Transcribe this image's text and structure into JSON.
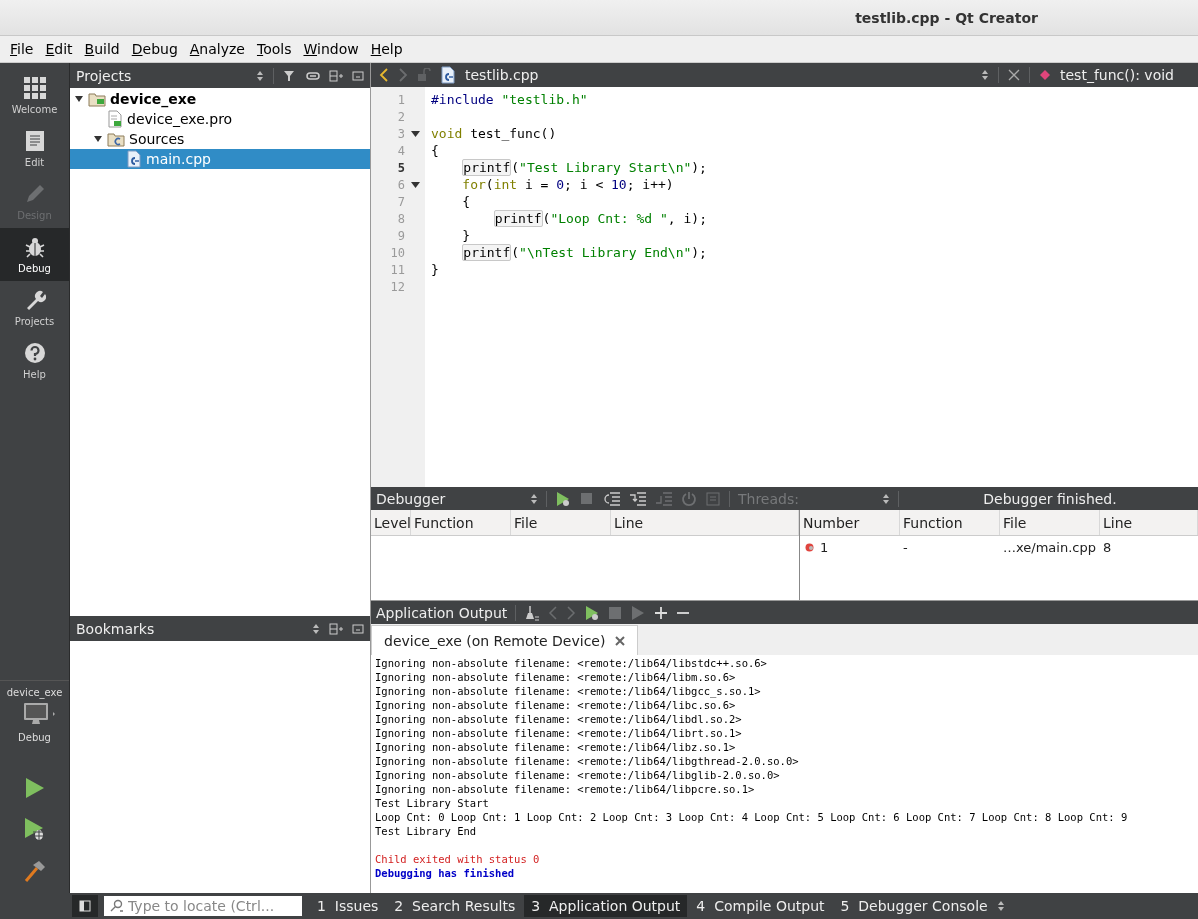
{
  "window": {
    "title": "testlib.cpp - Qt Creator"
  },
  "menu": [
    "File",
    "Edit",
    "Build",
    "Debug",
    "Analyze",
    "Tools",
    "Window",
    "Help"
  ],
  "modes": [
    {
      "label": "Welcome",
      "selected": false,
      "disabled": false
    },
    {
      "label": "Edit",
      "selected": false,
      "disabled": false
    },
    {
      "label": "Design",
      "selected": false,
      "disabled": true
    },
    {
      "label": "Debug",
      "selected": true,
      "disabled": false
    },
    {
      "label": "Projects",
      "selected": false,
      "disabled": false
    },
    {
      "label": "Help",
      "selected": false,
      "disabled": false
    }
  ],
  "kit": {
    "project": "device_exe",
    "build": "Debug"
  },
  "projects": {
    "title": "Projects",
    "tree": [
      {
        "label": "device_exe",
        "kind": "project",
        "bold": true,
        "expanded": true,
        "selected": false,
        "children": [
          {
            "label": "device_exe.pro",
            "kind": "pro",
            "bold": false,
            "selected": false
          },
          {
            "label": "Sources",
            "kind": "folder",
            "bold": false,
            "expanded": true,
            "selected": false,
            "children": [
              {
                "label": "main.cpp",
                "kind": "cpp",
                "bold": false,
                "selected": true
              }
            ]
          }
        ]
      }
    ]
  },
  "bookmarks": {
    "title": "Bookmarks"
  },
  "editor": {
    "file": "testlib.cpp",
    "symbol": "test_func(): void",
    "lines": [
      {
        "number": "1",
        "fold": false,
        "current": false,
        "tokens": [
          {
            "kind": "preproc",
            "text": "#include "
          },
          {
            "kind": "string",
            "text": "\"testlib.h\""
          }
        ]
      },
      {
        "number": "2",
        "fold": false,
        "current": false
      },
      {
        "number": "3",
        "fold": true,
        "current": false,
        "tokens": [
          {
            "kind": "keyword",
            "text": "void"
          },
          {
            "kind": "plain",
            "text": " test_func()"
          }
        ]
      },
      {
        "number": "4",
        "fold": false,
        "current": false,
        "tokens": [
          {
            "kind": "plain",
            "text": "{"
          }
        ]
      },
      {
        "number": "5",
        "fold": false,
        "current": true,
        "tokens": [
          {
            "kind": "func",
            "text": "    printf"
          },
          {
            "kind": "plain",
            "text": "("
          },
          {
            "kind": "string",
            "text": "\"Test Library Start\\n\""
          },
          {
            "kind": "plain",
            "text": ");"
          }
        ]
      },
      {
        "number": "6",
        "fold": true,
        "current": false,
        "tokens": [
          {
            "kind": "keyword",
            "text": "    for"
          },
          {
            "kind": "plain",
            "text": "("
          },
          {
            "kind": "keyword",
            "text": "int"
          },
          {
            "kind": "plain",
            "text": " i = "
          },
          {
            "kind": "number",
            "text": "0"
          },
          {
            "kind": "plain",
            "text": "; i < "
          },
          {
            "kind": "number",
            "text": "10"
          },
          {
            "kind": "plain",
            "text": "; i++)"
          }
        ]
      },
      {
        "number": "7",
        "fold": false,
        "current": false,
        "tokens": [
          {
            "kind": "plain",
            "text": "    {"
          }
        ]
      },
      {
        "number": "8",
        "fold": false,
        "current": false,
        "tokens": [
          {
            "kind": "func",
            "text": "        printf"
          },
          {
            "kind": "plain",
            "text": "("
          },
          {
            "kind": "string",
            "text": "\"Loop Cnt: %d \""
          },
          {
            "kind": "plain",
            "text": ", i);"
          }
        ]
      },
      {
        "number": "9",
        "fold": false,
        "current": false,
        "tokens": [
          {
            "kind": "plain",
            "text": "    }"
          }
        ]
      },
      {
        "number": "10",
        "fold": false,
        "current": false,
        "tokens": [
          {
            "kind": "func",
            "text": "    printf"
          },
          {
            "kind": "plain",
            "text": "("
          },
          {
            "kind": "string",
            "text": "\"\\nTest Library End\\n\""
          },
          {
            "kind": "plain",
            "text": ");"
          }
        ]
      },
      {
        "number": "11",
        "fold": false,
        "current": false,
        "tokens": [
          {
            "kind": "plain",
            "text": "}"
          }
        ]
      },
      {
        "number": "12",
        "fold": false,
        "current": false
      }
    ]
  },
  "debugger": {
    "title": "Debugger",
    "threads_label": "Threads:",
    "status": "Debugger finished.",
    "stack_columns": [
      "Level",
      "Function",
      "File",
      "Line"
    ],
    "breakpoint_columns": [
      "Number",
      "Function",
      "File",
      "Line"
    ],
    "breakpoints": [
      {
        "number": "1",
        "function": "-",
        "file": "…xe/main.cpp",
        "line": "8"
      }
    ]
  },
  "output": {
    "title": "Application Output",
    "tab": "device_exe (on Remote Device)",
    "lines": [
      {
        "kind": "normal",
        "text": "Ignoring non-absolute filename: <remote:/lib64/libstdc++.so.6>"
      },
      {
        "kind": "normal",
        "text": "Ignoring non-absolute filename: <remote:/lib64/libm.so.6>"
      },
      {
        "kind": "normal",
        "text": "Ignoring non-absolute filename: <remote:/lib64/libgcc_s.so.1>"
      },
      {
        "kind": "normal",
        "text": "Ignoring non-absolute filename: <remote:/lib64/libc.so.6>"
      },
      {
        "kind": "normal",
        "text": "Ignoring non-absolute filename: <remote:/lib64/libdl.so.2>"
      },
      {
        "kind": "normal",
        "text": "Ignoring non-absolute filename: <remote:/lib64/librt.so.1>"
      },
      {
        "kind": "normal",
        "text": "Ignoring non-absolute filename: <remote:/lib64/libz.so.1>"
      },
      {
        "kind": "normal",
        "text": "Ignoring non-absolute filename: <remote:/lib64/libgthread-2.0.so.0>"
      },
      {
        "kind": "normal",
        "text": "Ignoring non-absolute filename: <remote:/lib64/libglib-2.0.so.0>"
      },
      {
        "kind": "normal",
        "text": "Ignoring non-absolute filename: <remote:/lib64/libpcre.so.1>"
      },
      {
        "kind": "normal",
        "text": "Test Library Start"
      },
      {
        "kind": "normal",
        "text": "Loop Cnt: 0 Loop Cnt: 1 Loop Cnt: 2 Loop Cnt: 3 Loop Cnt: 4 Loop Cnt: 5 Loop Cnt: 6 Loop Cnt: 7 Loop Cnt: 8 Loop Cnt: 9"
      },
      {
        "kind": "normal",
        "text": "Test Library End"
      },
      {
        "kind": "blank"
      },
      {
        "kind": "error",
        "text": "Child exited with status 0"
      },
      {
        "kind": "info",
        "text": "Debugging has finished"
      }
    ]
  },
  "status_bar": {
    "locate_placeholder": "Type to locate (Ctrl...",
    "panes": [
      {
        "number": "1",
        "label": "Issues",
        "selected": false
      },
      {
        "number": "2",
        "label": "Search Results",
        "selected": false
      },
      {
        "number": "3",
        "label": "Application Output",
        "selected": true
      },
      {
        "number": "4",
        "label": "Compile Output",
        "selected": false
      },
      {
        "number": "5",
        "label": "Debugger Console",
        "selected": false
      }
    ]
  }
}
